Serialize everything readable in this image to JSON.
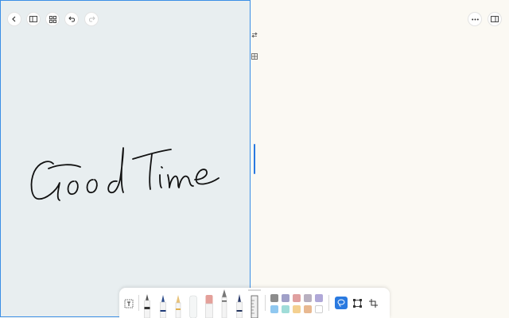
{
  "left_page": {
    "handwriting": "Good Time"
  },
  "icons": {
    "back": "chevron-left-icon",
    "sidebar": "sidebar-icon",
    "grid": "grid-icon",
    "undo": "undo-icon",
    "redo": "redo-icon",
    "more": "more-icon",
    "split": "split-view-icon"
  },
  "toolbar": {
    "tools": [
      "text-box-tool",
      "fountain-pen",
      "ballpoint-pen",
      "pencil",
      "highlighter",
      "eraser",
      "brush-pen",
      "fineliner",
      "ruler"
    ],
    "colors": [
      "#8c8c8c",
      "#a0a0c8",
      "#e0a0a0",
      "#b8b0c0",
      "#b0a8d8",
      "#90c8f0",
      "#a0dcd8",
      "#f4d090",
      "#e8b890",
      "#ffffff"
    ],
    "active_mode": "lasso",
    "modes": [
      "lasso",
      "select",
      "crop"
    ]
  },
  "colors": {
    "accent": "#2a7ae0",
    "left_bg": "#e8eef0",
    "right_bg": "#fbf9f3"
  }
}
